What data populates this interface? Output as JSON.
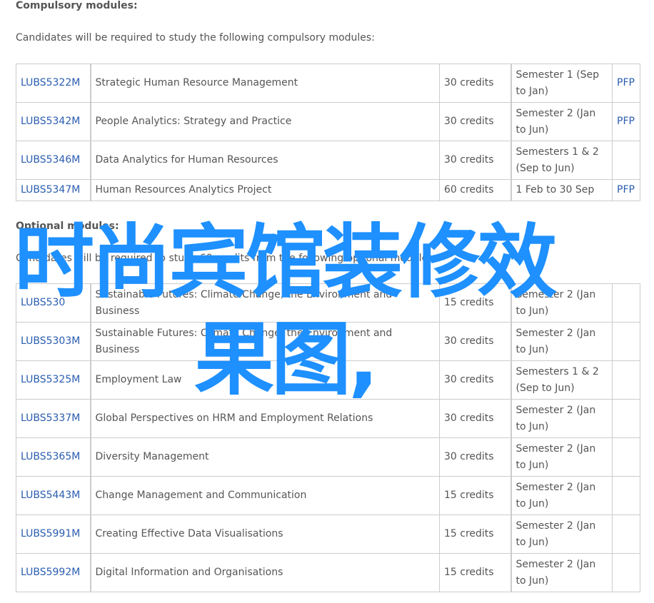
{
  "compulsory": {
    "heading": "Compulsory modules:",
    "intro": "Candidates will be required to study the following compulsory modules:",
    "rows": [
      {
        "code": "LUBS5322M",
        "title": "Strategic Human Resource Management",
        "credits": "30 credits",
        "semester": "Semester 1 (Sep to Jan)",
        "pfp": "PFP"
      },
      {
        "code": "LUBS5342M",
        "title": "People Analytics: Strategy and Practice",
        "credits": "30 credits",
        "semester": "Semester 2 (Jan to Jun)",
        "pfp": "PFP"
      },
      {
        "code": "LUBS5346M",
        "title": "Data Analytics for Human Resources",
        "credits": "30 credits",
        "semester": "Semesters 1 & 2 (Sep to Jun)",
        "pfp": ""
      },
      {
        "code": "LUBS5347M",
        "title": "Human Resources Analytics Project",
        "credits": "60 credits",
        "semester": "1 Feb to 30 Sep",
        "pfp": "PFP"
      }
    ]
  },
  "optional": {
    "heading": "Optional modules:",
    "intro": "Candidates will be required to study 60 credits from the following optional modules:",
    "rows": [
      {
        "code": "LUBS530",
        "title": "Sustainable Futures: Climate Change, the Environment and Business",
        "credits": "15 credits",
        "semester": "Semester 2 (Jan to Jun)",
        "pfp": ""
      },
      {
        "code": "LUBS5303M",
        "title": "Sustainable Futures: Climate Change, the Environment and Business",
        "credits": "30 credits",
        "semester": "Semester 2 (Jan to Jun)",
        "pfp": ""
      },
      {
        "code": "LUBS5325M",
        "title": "Employment Law",
        "credits": "30 credits",
        "semester": "Semesters 1 & 2 (Sep to Jun)",
        "pfp": ""
      },
      {
        "code": "LUBS5337M",
        "title": "Global Perspectives on HRM and Employment Relations",
        "credits": "30 credits",
        "semester": "Semester 2 (Jan to Jun)",
        "pfp": ""
      },
      {
        "code": "LUBS5365M",
        "title": "Diversity Management",
        "credits": "30 credits",
        "semester": "Semester 2 (Jan to Jun)",
        "pfp": ""
      },
      {
        "code": "LUBS5443M",
        "title": "Change Management and Communication",
        "credits": "15 credits",
        "semester": "Semester 2 (Jan to Jun)",
        "pfp": ""
      },
      {
        "code": "LUBS5991M",
        "title": "Creating Effective Data Visualisations",
        "credits": "15 credits",
        "semester": "Semester 2 (Jan to Jun)",
        "pfp": ""
      },
      {
        "code": "LUBS5992M",
        "title": "Digital Information and Organisations",
        "credits": "15 credits",
        "semester": "Semester 2 (Jan to Jun)",
        "pfp": ""
      }
    ]
  },
  "overlay": {
    "line1": "时尚宾馆装修效",
    "line2": "果图,",
    "color": "#1e90ff"
  },
  "colors": {
    "link": "#2a5db0",
    "text": "#555555",
    "border": "#cccccc"
  }
}
